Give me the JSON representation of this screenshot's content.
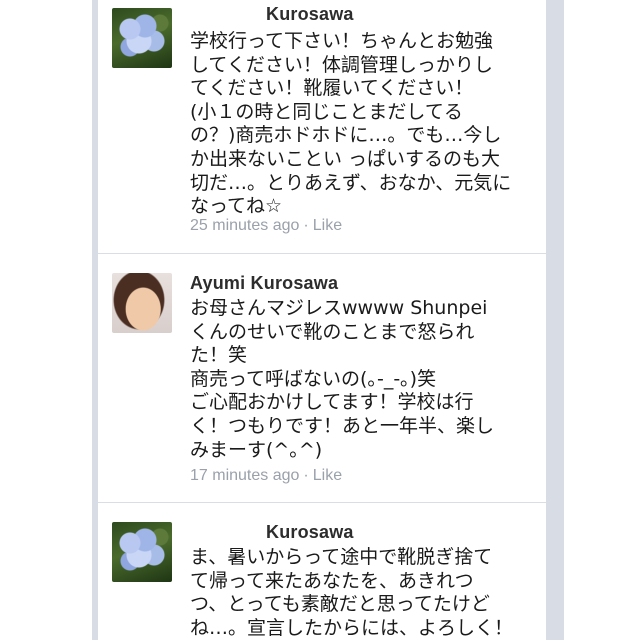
{
  "comments": [
    {
      "author": "Kurosawa",
      "text": "学校行って下さい！ちゃんとお勉強\nしてください！体調管理しっかりし\nてください！靴履いてください！\n(小１の時と同じことまだしてる\nの？)商売ホドホドに…。でも…今し\nか出来ないことい っぱいするのも大\n切だ…。とりあえず、おなか、元気に\nなってね☆",
      "time": "25 minutes ago",
      "separator": "·",
      "like": "Like",
      "avatar": "hydrangea-photo"
    },
    {
      "author": "Ayumi Kurosawa",
      "text": "お母さんマジレスwwww Shunpei\nくんのせいで靴のことまで怒られ\nた！笑\n商売って呼ばないの(｡-_-｡)笑\nご心配おかけしてます！学校は行\nく！つもりです！あと一年半、楽し\nみまーす(^｡^)",
      "time": "17 minutes ago",
      "separator": "·",
      "like": "Like",
      "avatar": "woman-portrait-photo"
    },
    {
      "author": "Kurosawa",
      "text": "ま、暑いからって途中で靴脱ぎ捨て\nて帰って来たあなたを、あきれつ\nつ、とっても素敵だと思ってたけど\nね…。宣言したからには、よろしく！",
      "avatar": "hydrangea-photo"
    }
  ]
}
